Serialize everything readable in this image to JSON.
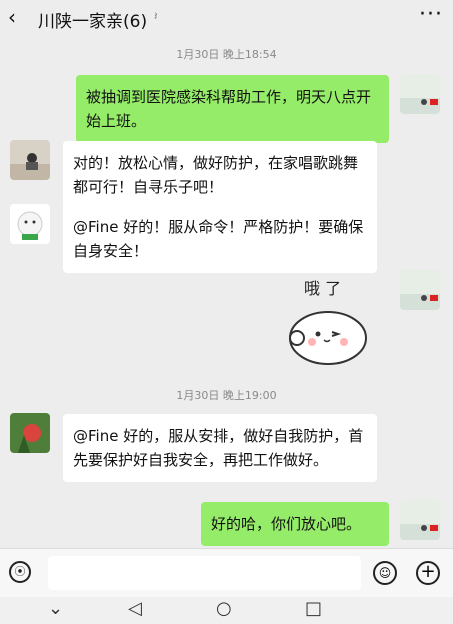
{
  "header": {
    "title": "川陕一家亲(6)",
    "back_icon": "chevron-left-icon",
    "mute_icon": "mute-ear-icon",
    "more_icon": "more-dots-icon"
  },
  "times": [
    "1月30日 晚上18:54",
    "1月30日 晚上19:00"
  ],
  "messages": [
    {
      "side": "right",
      "text": "被抽调到医院感染科帮助工作，明天八点开始上班。"
    },
    {
      "side": "left",
      "text": "对的！放松心情，做好防护，在家唱歌跳舞都可行！自寻乐子吧！"
    },
    {
      "side": "left",
      "text": "@Fine 好的！服从命令！严格防护！要确保自身安全！"
    },
    {
      "side": "right",
      "sticker_text": "哦 了"
    },
    {
      "side": "left",
      "text": "@Fine 好的，服从安排，做好自我防护，首先要保护好自我安全，再把工作做好。"
    },
    {
      "side": "right",
      "text": "好的哈，你们放心吧。"
    }
  ],
  "inputbar": {
    "voice_icon": "voice-icon",
    "input_value": "",
    "emoji_icon": "emoji-icon",
    "plus_icon": "plus-icon"
  },
  "navbar": {
    "back": "◁",
    "home": "○",
    "recents": "□",
    "down": "⌄"
  },
  "colors": {
    "bubble_right": "#95ec69",
    "bubble_left": "#ffffff",
    "background": "#ededed"
  }
}
